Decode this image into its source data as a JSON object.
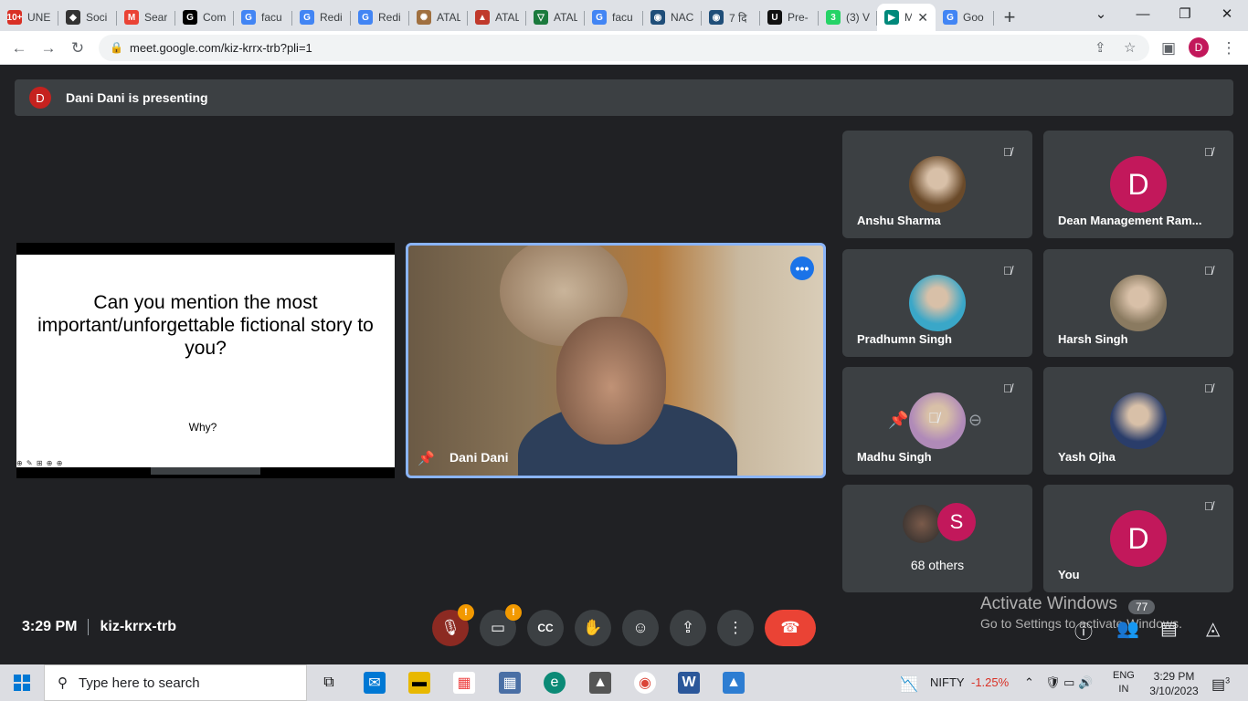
{
  "browser": {
    "tabs": [
      {
        "title": "UNE",
        "fav": "10+",
        "color": "#d93025"
      },
      {
        "title": "Soci",
        "fav": "◆",
        "color": "#333333"
      },
      {
        "title": "Sear",
        "fav": "M",
        "color": "#ea4335"
      },
      {
        "title": "Com",
        "fav": "G",
        "color": "#000000"
      },
      {
        "title": "facu",
        "fav": "G",
        "color": "#4285f4"
      },
      {
        "title": "Redi",
        "fav": "G",
        "color": "#4285f4"
      },
      {
        "title": "Redi",
        "fav": "G",
        "color": "#4285f4"
      },
      {
        "title": "ATAL",
        "fav": "✺",
        "color": "#a07040"
      },
      {
        "title": "ATAL",
        "fav": "▲",
        "color": "#c0392b"
      },
      {
        "title": "ATAL",
        "fav": "▽",
        "color": "#1b7a3d"
      },
      {
        "title": "facu",
        "fav": "G",
        "color": "#4285f4"
      },
      {
        "title": "NAC",
        "fav": "◉",
        "color": "#1f4e79"
      },
      {
        "title": "7 दि",
        "fav": "◉",
        "color": "#1f4e79"
      },
      {
        "title": "Pre-",
        "fav": "U",
        "color": "#111111"
      },
      {
        "title": "(3) V",
        "fav": "3",
        "color": "#25d366"
      }
    ],
    "active_tab": {
      "title": "M",
      "fav": "▶",
      "color": "#00897b"
    },
    "last_tab": {
      "title": "Goo",
      "fav": "G",
      "color": "#4285f4"
    },
    "url": "meet.google.com/kiz-krrx-trb?pli=1",
    "profile_letter": "D"
  },
  "meet": {
    "presenter_avatar": "D",
    "presenting_text": "Dani Dani is presenting",
    "slide": {
      "question": "Can you mention the most important/unforgettable fictional story to you?",
      "sub": "Why?",
      "tools": "⊕ ✎ ⊞ ⊕ ⊕"
    },
    "main_speaker": "Dani Dani",
    "participants": [
      {
        "name": "Anshu Sharma",
        "type": "photo",
        "tone": "#6a4a2a"
      },
      {
        "name": "Dean Management Ram...",
        "type": "letter",
        "letter": "D"
      },
      {
        "name": "Pradhumn Singh",
        "type": "photo",
        "tone": "#3aa7c8"
      },
      {
        "name": "Harsh Singh",
        "type": "photo",
        "tone": "#8a7a60"
      },
      {
        "name": "Madhu Singh",
        "type": "photo",
        "tone": "#b08ab8"
      },
      {
        "name": "Yash Ojha",
        "type": "photo",
        "tone": "#2a3d6a"
      }
    ],
    "others": {
      "count_label": "68 others",
      "letter": "S"
    },
    "self": {
      "name": "You",
      "letter": "D"
    },
    "time": "3:29 PM",
    "meeting_code": "kiz-krrx-trb",
    "warn_mark": "!",
    "activate": {
      "line1": "Activate Windows",
      "line2": "Go to Settings to activate Windows."
    },
    "badge": "77"
  },
  "taskbar": {
    "search_placeholder": "Type here to search",
    "nifty_label": "NIFTY",
    "nifty_change": "-1.25%",
    "lang": "ENG",
    "region": "IN",
    "clock_time": "3:29 PM",
    "clock_date": "3/10/2023",
    "notif_count": "3"
  }
}
